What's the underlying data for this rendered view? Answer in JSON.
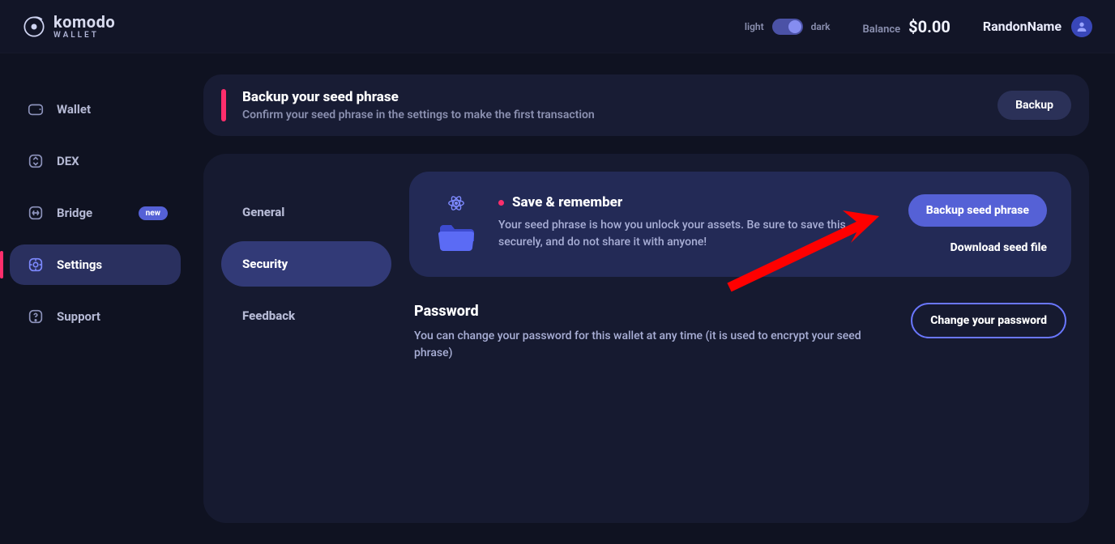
{
  "brand": {
    "name": "komodo",
    "sub": "WALLET"
  },
  "theme": {
    "light_label": "light",
    "dark_label": "dark"
  },
  "balance": {
    "label": "Balance",
    "value": "$0.00"
  },
  "user": {
    "name": "RandonName"
  },
  "sidebar": {
    "items": [
      {
        "label": "Wallet"
      },
      {
        "label": "DEX"
      },
      {
        "label": "Bridge",
        "badge": "new"
      },
      {
        "label": "Settings"
      },
      {
        "label": "Support"
      }
    ]
  },
  "banner": {
    "title": "Backup your seed phrase",
    "subtitle": "Confirm your seed phrase in the settings to make the first transaction",
    "button": "Backup"
  },
  "settingsTabs": {
    "general": "General",
    "security": "Security",
    "feedback": "Feedback"
  },
  "seed": {
    "title": "Save & remember",
    "desc": "Your seed phrase is how you unlock your assets. Be sure to save this securely, and do not share it with anyone!",
    "backup_btn": "Backup seed phrase",
    "download_link": "Download seed file"
  },
  "password": {
    "title": "Password",
    "desc": "You can change your password for this wallet at any time (it is used to encrypt your seed phrase)",
    "change_btn": "Change your password"
  }
}
